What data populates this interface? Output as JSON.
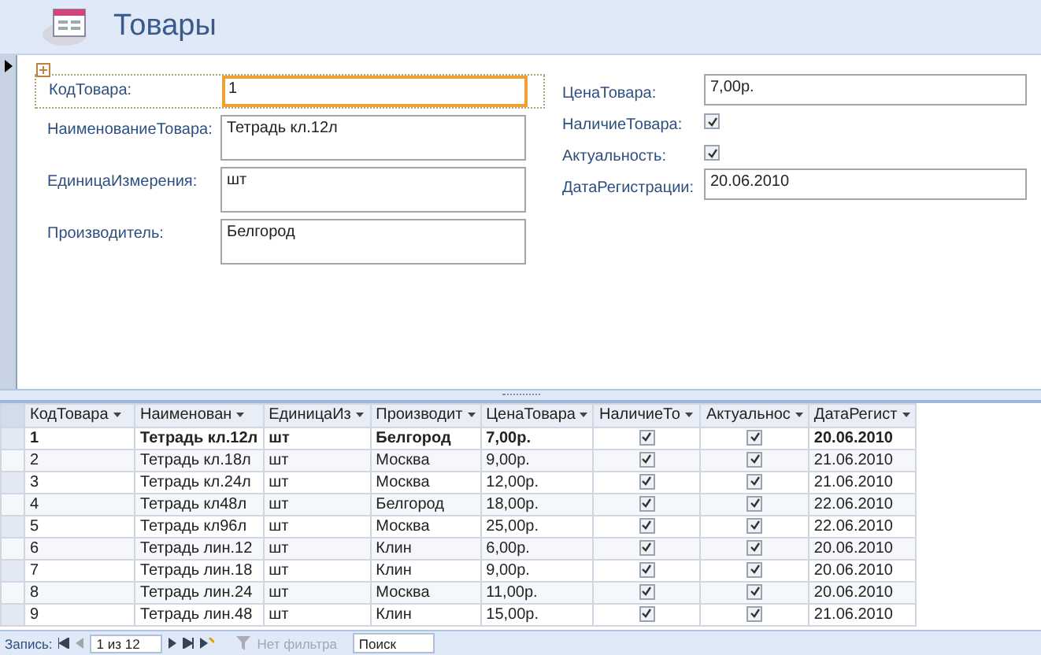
{
  "header": {
    "title": "Товары"
  },
  "form": {
    "left_fields": [
      {
        "kind": "text",
        "label": "КодТовара:",
        "value": "1",
        "focused": true,
        "tall": false
      },
      {
        "kind": "text",
        "label": "НаименованиеТовара:",
        "value": "Тетрадь кл.12л",
        "focused": false,
        "tall": true
      },
      {
        "kind": "text",
        "label": "ЕдиницаИзмерения:",
        "value": "шт",
        "focused": false,
        "tall": true
      },
      {
        "kind": "text",
        "label": "Производитель:",
        "value": "Белгород",
        "focused": false,
        "tall": true
      }
    ],
    "right_fields": [
      {
        "kind": "text",
        "label": "ЦенаТовара:",
        "value": "7,00р."
      },
      {
        "kind": "check",
        "label": "НаличиеТовара:",
        "checked": true
      },
      {
        "kind": "check",
        "label": "Актуальность:",
        "checked": true
      },
      {
        "kind": "text",
        "label": "ДатаРегистрации:",
        "value": "20.06.2010"
      }
    ]
  },
  "datasheet": {
    "columns": [
      {
        "kind": "text",
        "label": "КодТовара"
      },
      {
        "kind": "text",
        "label": "Наименован"
      },
      {
        "kind": "text",
        "label": "ЕдиницаИз"
      },
      {
        "kind": "text",
        "label": "Производит"
      },
      {
        "kind": "text",
        "label": "ЦенаТовара"
      },
      {
        "kind": "check",
        "label": "НаличиеТо"
      },
      {
        "kind": "check",
        "label": "Актуальнос"
      },
      {
        "kind": "text",
        "label": "ДатаРегист"
      }
    ],
    "rows": [
      {
        "selected": true,
        "values": [
          "1",
          "Тетрадь кл.12л",
          "шт",
          "Белгород",
          "7,00р.",
          true,
          true,
          "20.06.2010"
        ]
      },
      {
        "selected": false,
        "values": [
          "2",
          "Тетрадь кл.18л",
          "шт",
          "Москва",
          "9,00р.",
          true,
          true,
          "21.06.2010"
        ]
      },
      {
        "selected": false,
        "values": [
          "3",
          "Тетрадь кл.24л",
          "шт",
          "Москва",
          "12,00р.",
          true,
          true,
          "21.06.2010"
        ]
      },
      {
        "selected": false,
        "values": [
          "4",
          "Тетрадь кл48л",
          "шт",
          "Белгород",
          "18,00р.",
          true,
          true,
          "22.06.2010"
        ]
      },
      {
        "selected": false,
        "values": [
          "5",
          "Тетрадь кл96л",
          "шт",
          "Москва",
          "25,00р.",
          true,
          true,
          "22.06.2010"
        ]
      },
      {
        "selected": false,
        "values": [
          "6",
          "Тетрадь лин.12",
          "шт",
          "Клин",
          "6,00р.",
          true,
          true,
          "20.06.2010"
        ]
      },
      {
        "selected": false,
        "values": [
          "7",
          "Тетрадь лин.18",
          "шт",
          "Клин",
          "9,00р.",
          true,
          true,
          "20.06.2010"
        ]
      },
      {
        "selected": false,
        "values": [
          "8",
          "Тетрадь лин.24",
          "шт",
          "Москва",
          "11,00р.",
          true,
          true,
          "20.06.2010"
        ]
      },
      {
        "selected": false,
        "values": [
          "9",
          "Тетрадь лин.48",
          "шт",
          "Клин",
          "15,00р.",
          true,
          true,
          "21.06.2010"
        ]
      }
    ]
  },
  "navigation": {
    "label": "Запись:",
    "position": "1 из 12",
    "filter": "Нет фильтра",
    "search_placeholder": "Поиск"
  }
}
